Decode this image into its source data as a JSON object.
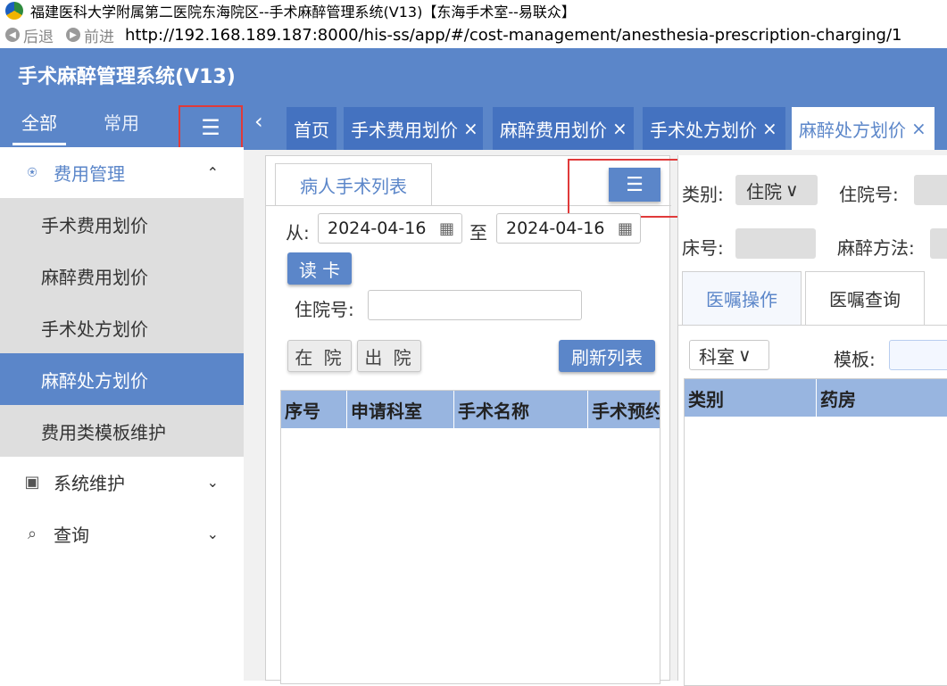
{
  "window": {
    "title": "福建医科大学附属第二医院东海院区--手术麻醉管理系统(V13)【东海手术室--易联众】"
  },
  "addressbar": {
    "back_label": "后退",
    "forward_label": "前进",
    "url": "http://192.168.189.187:8000/his-ss/app/#/cost-management/anesthesia-prescription-charging/1"
  },
  "header": {
    "app_title": "手术麻醉管理系统(V13)"
  },
  "sidebar": {
    "tabs": [
      {
        "label": "全部",
        "active": true
      },
      {
        "label": "常用",
        "active": false
      }
    ],
    "menu_toggle_icon": "menu-collapse-icon",
    "groups": [
      {
        "label": "费用管理",
        "icon": "money-icon",
        "expanded": true,
        "items": [
          {
            "label": "手术费用划价"
          },
          {
            "label": "麻醉费用划价"
          },
          {
            "label": "手术处方划价"
          },
          {
            "label": "麻醉处方划价",
            "active": true
          },
          {
            "label": "费用类模板维护"
          }
        ]
      },
      {
        "label": "系统维护",
        "icon": "monitor-icon",
        "expanded": false
      },
      {
        "label": "查询",
        "icon": "search-doc-icon",
        "expanded": false
      }
    ]
  },
  "tabs": {
    "prev_icon": "chevron-left-icon",
    "items": [
      {
        "label": "首页",
        "closable": false
      },
      {
        "label": "手术费用划价",
        "closable": true
      },
      {
        "label": "麻醉费用划价",
        "closable": true
      },
      {
        "label": "手术处方划价",
        "closable": true
      },
      {
        "label": "麻醉处方划价",
        "closable": true,
        "active": true
      }
    ],
    "close_glyph": "×"
  },
  "left_panel": {
    "tab_label": "病人手术列表",
    "from_label": "从:",
    "from_date": "2024-04-16",
    "to_label": "至",
    "to_date": "2024-04-16",
    "read_card_label": "读 卡",
    "inpatient_no_label": "住院号:",
    "inpatient_no_value": "",
    "in_hospital_label": "在 院",
    "discharged_label": "出 院",
    "refresh_label": "刷新列表",
    "columns": [
      "序号",
      "申请科室",
      "手术名称",
      "手术预约"
    ],
    "rows": []
  },
  "right_panel": {
    "category_label": "类别:",
    "category_value": "住院",
    "inpatient_no_label": "住院号:",
    "bed_no_label": "床号:",
    "anesthesia_method_label": "麻醉方法:",
    "tabs": [
      {
        "label": "医嘱操作",
        "active": true
      },
      {
        "label": "医嘱查询",
        "active": false
      }
    ],
    "dept_label": "科室",
    "template_label": "模板:",
    "columns": [
      "类别",
      "药房"
    ],
    "rows": []
  },
  "colors": {
    "primary": "#5b86c9",
    "tab_inactive": "#4472c0",
    "grid_header": "#98b5e0",
    "highlight_border": "#e03a3a"
  }
}
